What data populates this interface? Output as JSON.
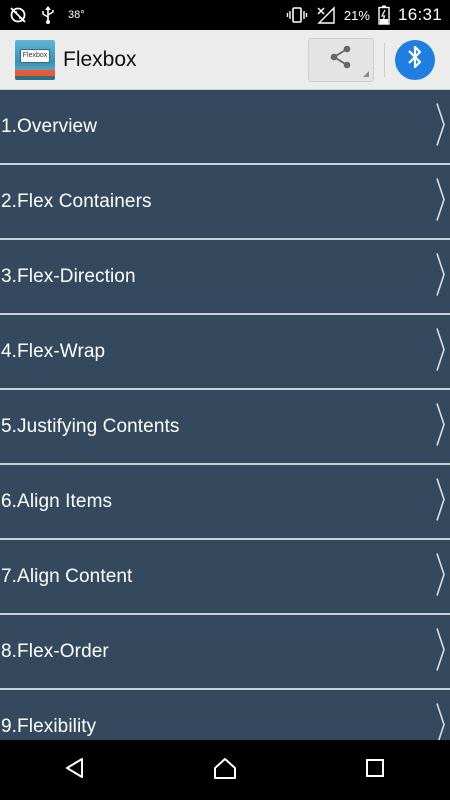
{
  "status_bar": {
    "temperature": "38°",
    "battery_percent": "21%",
    "time": "16:31",
    "icons": [
      "no-sync-icon",
      "usb-icon",
      "vibrate-icon",
      "no-signal-icon",
      "battery-icon"
    ]
  },
  "app_bar": {
    "title": "Flexbox",
    "logo_text": "Flexbox",
    "actions": [
      "share-icon",
      "bluetooth-icon"
    ]
  },
  "menu": {
    "items": [
      {
        "label": "1.Overview"
      },
      {
        "label": "2.Flex Containers"
      },
      {
        "label": "3.Flex-Direction"
      },
      {
        "label": "4.Flex-Wrap"
      },
      {
        "label": "5.Justifying Contents"
      },
      {
        "label": "6.Align Items"
      },
      {
        "label": "7.Align Content"
      },
      {
        "label": "8.Flex-Order"
      },
      {
        "label": "9.Flexibility"
      }
    ]
  },
  "nav_bar": {
    "buttons": [
      "back-icon",
      "home-icon",
      "recents-icon"
    ]
  },
  "colors": {
    "list_background": "#34495e",
    "divider": "#c9d1d9",
    "bluetooth_accent": "#1e7fe0",
    "app_bar_background": "#ececec"
  }
}
